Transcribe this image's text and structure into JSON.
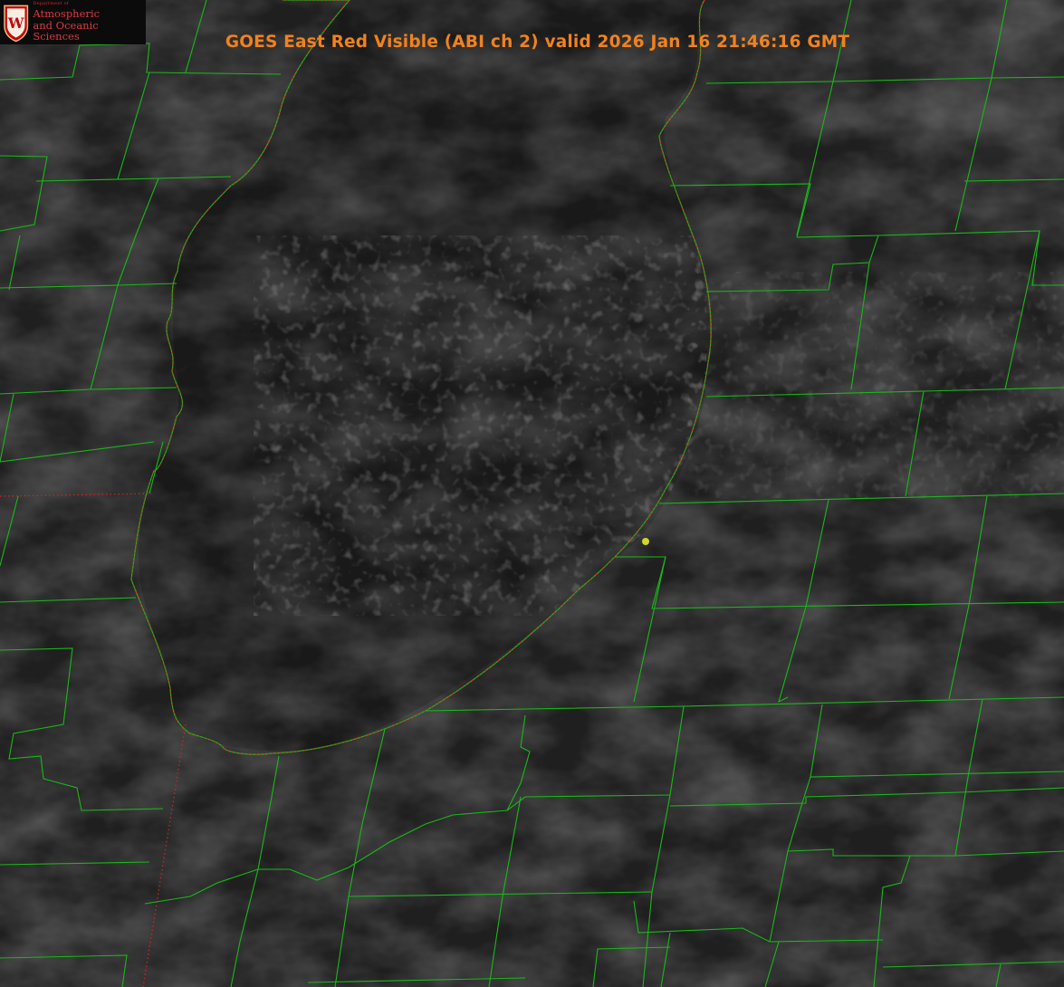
{
  "title": "GOES East Red Visible (ABI ch 2) valid 2026 Jan 16 21:46:16 GMT",
  "logo": {
    "department": "Department of",
    "line1": "Atmospheric",
    "line2": "and Oceanic Sciences",
    "letter": "W"
  },
  "colors": {
    "boundary": "#19b819",
    "shoreline": "#e02020",
    "title": "#f0821e",
    "station_marker": "#d4d42a",
    "logo_text": "#e0373f"
  },
  "station_marker": "yellow-dot"
}
